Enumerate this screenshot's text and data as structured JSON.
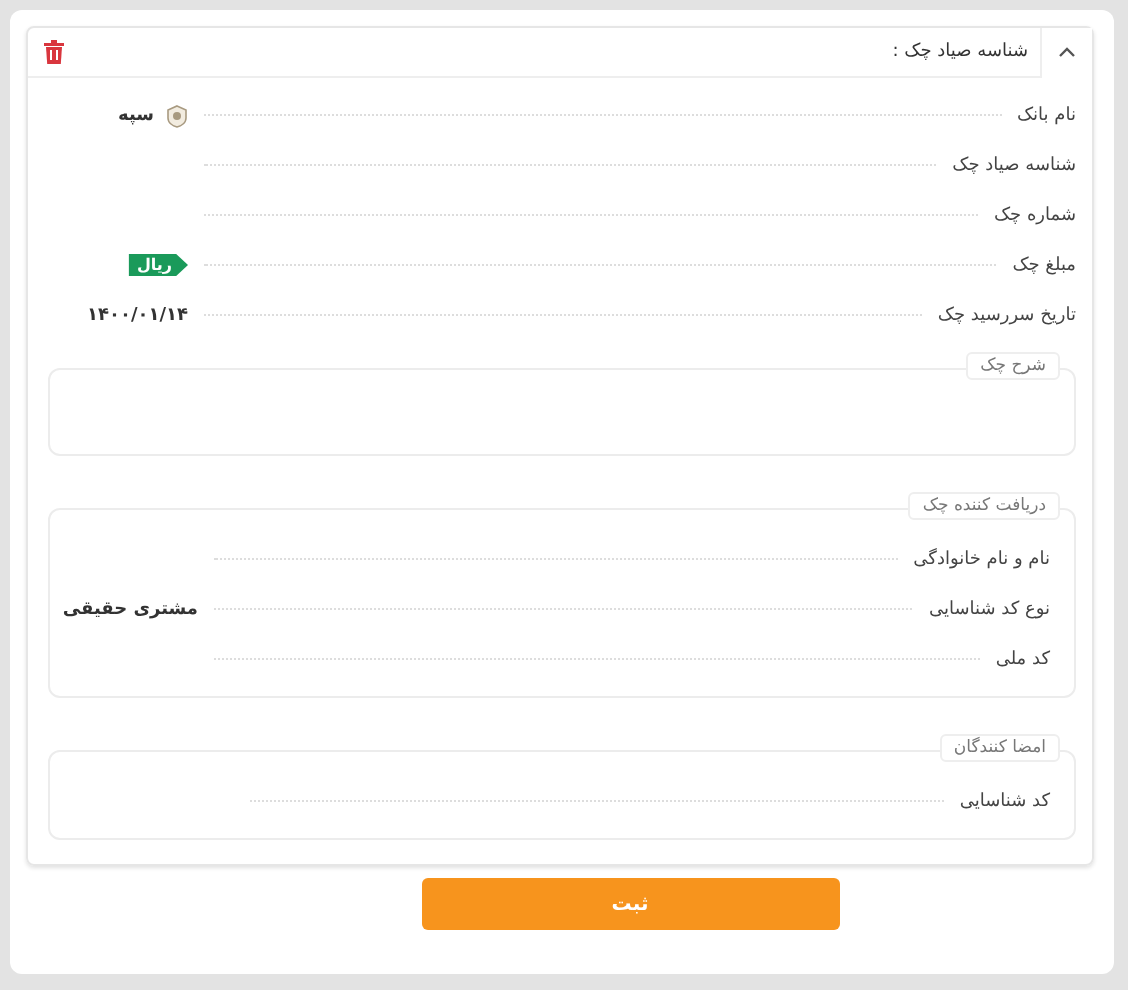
{
  "card": {
    "title": "شناسه صیاد چک :",
    "expanded": true
  },
  "fields": [
    {
      "label": "نام بانک",
      "value": "سپه",
      "kind": "bank"
    },
    {
      "label": "شناسه صیاد چک",
      "kind": "text"
    },
    {
      "label": "شماره چک",
      "kind": "text"
    },
    {
      "label": "مبلغ چک",
      "kind": "amount",
      "unit": "ریال"
    },
    {
      "label": "تاریخ سررسید چک",
      "value": "۱۴۰۰/۰۱/۱۴",
      "kind": "text"
    }
  ],
  "description": {
    "legend": "شرح چک"
  },
  "receiver": {
    "legend": "دریافت کننده چک",
    "fields": [
      {
        "label": "نام و نام خانوادگی"
      },
      {
        "label": "نوع کد شناسایی",
        "value": "مشتری حقیقی"
      },
      {
        "label": "کد ملی"
      }
    ]
  },
  "signers": {
    "legend": "امضا کنندگان",
    "fields": [
      {
        "label": "کد شناسایی"
      }
    ]
  },
  "submit": "ثبت"
}
